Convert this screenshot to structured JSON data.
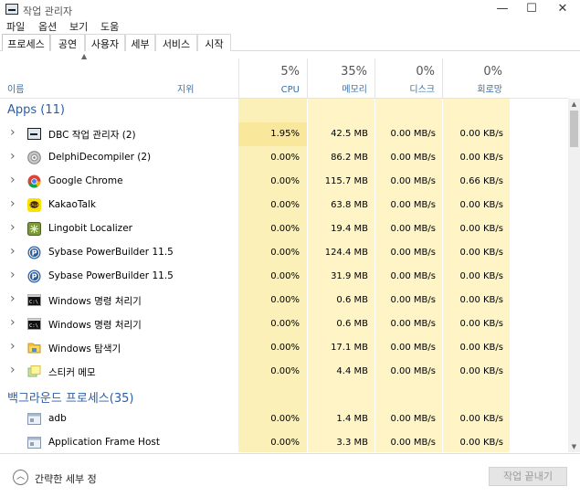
{
  "window": {
    "title": "작업 관리자",
    "controls": {
      "minimize": "—",
      "maximize": "☐",
      "close": "✕"
    }
  },
  "menu": [
    "파일",
    "옵션",
    "보기",
    "도움"
  ],
  "tabs": [
    "프로세스",
    "공연",
    "사용자",
    "세부",
    "서비스",
    "시작"
  ],
  "header": {
    "name": "이름",
    "status": "지위",
    "cpu": {
      "pct": "5%",
      "label": "CPU"
    },
    "memory": {
      "pct": "35%",
      "label": "메모리"
    },
    "disk": {
      "pct": "0%",
      "label": "디스크"
    },
    "network": {
      "pct": "0%",
      "label": "회로망"
    }
  },
  "groups": {
    "apps": "Apps (11)",
    "background": "백그라운드 프로세스(35)"
  },
  "apps": [
    {
      "name": "DBC 작업 관리자 (2)",
      "icon": "dbc-icon",
      "cpu": "1.95%",
      "mem": "42.5 MB",
      "disk": "0.00 MB/s",
      "net": "0.00 KB/s"
    },
    {
      "name": "DelphiDecompiler (2)",
      "icon": "gear-disc-icon",
      "cpu": "0.00%",
      "mem": "86.2 MB",
      "disk": "0.00 MB/s",
      "net": "0.00 KB/s"
    },
    {
      "name": "Google Chrome",
      "icon": "chrome-icon",
      "cpu": "0.00%",
      "mem": "115.7 MB",
      "disk": "0.00 MB/s",
      "net": "0.66 KB/s"
    },
    {
      "name": "KakaoTalk",
      "icon": "kakaotalk-icon",
      "cpu": "0.00%",
      "mem": "63.8 MB",
      "disk": "0.00 MB/s",
      "net": "0.00 KB/s"
    },
    {
      "name": "Lingobit Localizer",
      "icon": "lingobit-icon",
      "cpu": "0.00%",
      "mem": "19.4 MB",
      "disk": "0.00 MB/s",
      "net": "0.00 KB/s"
    },
    {
      "name": "Sybase PowerBuilder 11.5",
      "icon": "powerbuilder-icon",
      "cpu": "0.00%",
      "mem": "124.4 MB",
      "disk": "0.00 MB/s",
      "net": "0.00 KB/s"
    },
    {
      "name": "Sybase PowerBuilder 11.5",
      "icon": "powerbuilder-icon",
      "cpu": "0.00%",
      "mem": "31.9 MB",
      "disk": "0.00 MB/s",
      "net": "0.00 KB/s"
    },
    {
      "name": "Windows 명령 처리기",
      "icon": "cmd-icon",
      "cpu": "0.00%",
      "mem": "0.6 MB",
      "disk": "0.00 MB/s",
      "net": "0.00 KB/s"
    },
    {
      "name": "Windows 명령 처리기",
      "icon": "cmd-icon",
      "cpu": "0.00%",
      "mem": "0.6 MB",
      "disk": "0.00 MB/s",
      "net": "0.00 KB/s"
    },
    {
      "name": "Windows 탐색기",
      "icon": "explorer-folder-icon",
      "cpu": "0.00%",
      "mem": "17.1 MB",
      "disk": "0.00 MB/s",
      "net": "0.00 KB/s"
    },
    {
      "name": "스티커 메모",
      "icon": "sticky-notes-icon",
      "cpu": "0.00%",
      "mem": "4.4 MB",
      "disk": "0.00 MB/s",
      "net": "0.00 KB/s"
    }
  ],
  "background": [
    {
      "name": "adb",
      "icon": "generic-process-icon",
      "cpu": "0.00%",
      "mem": "1.4 MB",
      "disk": "0.00 MB/s",
      "net": "0.00 KB/s"
    },
    {
      "name": "Application Frame Host",
      "icon": "generic-process-icon",
      "cpu": "0.00%",
      "mem": "3.3 MB",
      "disk": "0.00 MB/s",
      "net": "0.00 KB/s"
    }
  ],
  "footer": {
    "fewer_details": "간략한 세부 정",
    "end_task": "작업 끝내기"
  },
  "colors": {
    "accent": "#2a5ea8",
    "cpu_col": "#fbf0b8",
    "other_col": "#fff4c5",
    "cpu_highlight": "#f9e79c"
  }
}
